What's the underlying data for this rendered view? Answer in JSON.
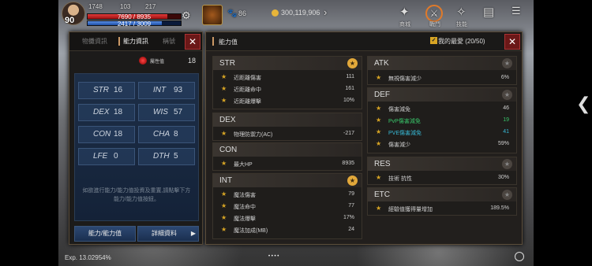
{
  "hud": {
    "level": "90",
    "buff1": "1748",
    "buff2": "103",
    "buff3": "217",
    "hp": "7690 / 8935",
    "hp_fraction": 0.86,
    "mp": "2417 / 3009",
    "mp_fraction": 0.8,
    "kills": "86",
    "gold": "300,119,906",
    "menu_labels": [
      "商城",
      "戰鬥",
      "技能"
    ]
  },
  "left": {
    "tabs": [
      "物攤資訊",
      "能力資訊",
      "稱號"
    ],
    "element_name": "屬性值",
    "element_value": "18",
    "stats": [
      {
        "name": "STR",
        "value": "16"
      },
      {
        "name": "INT",
        "value": "93"
      },
      {
        "name": "DEX",
        "value": "18"
      },
      {
        "name": "WIS",
        "value": "57"
      },
      {
        "name": "CON",
        "value": "18"
      },
      {
        "name": "CHA",
        "value": "8"
      },
      {
        "name": "LFE",
        "value": "0"
      },
      {
        "name": "DTH",
        "value": "5"
      }
    ],
    "hint": "如欲進行能力/能力值投資及重置,請點擊下方能力/能力值按鈕。",
    "btn_ability": "能力/能力值",
    "btn_detail": "詳細資料"
  },
  "right": {
    "title": "能力值",
    "favorite": "我的最愛 (20/50)",
    "groups": {
      "str": {
        "name": "STR",
        "rows": [
          {
            "n": "近距離傷害",
            "v": "111"
          },
          {
            "n": "近距離命中",
            "v": "161"
          },
          {
            "n": "近距離爆擊",
            "v": "10%"
          }
        ]
      },
      "dex": {
        "name": "DEX",
        "rows": [
          {
            "n": "物理防禦力(AC)",
            "v": "-217"
          }
        ]
      },
      "con": {
        "name": "CON",
        "rows": [
          {
            "n": "最大HP",
            "v": "8935"
          }
        ]
      },
      "int": {
        "name": "INT",
        "rows": [
          {
            "n": "魔法傷害",
            "v": "79"
          },
          {
            "n": "魔法命中",
            "v": "77"
          },
          {
            "n": "魔法爆擊",
            "v": "17%"
          },
          {
            "n": "魔法加成(MB)",
            "v": "24"
          }
        ]
      },
      "atk": {
        "name": "ATK",
        "rows": [
          {
            "n": "無視傷害減少",
            "v": "6%"
          }
        ]
      },
      "def": {
        "name": "DEF",
        "rows": [
          {
            "n": "傷害減免",
            "v": "46"
          },
          {
            "n": "PvP傷害減免",
            "v": "19"
          },
          {
            "n": "PVE傷害減免",
            "v": "41"
          },
          {
            "n": "傷害減少",
            "v": "59%"
          }
        ]
      },
      "res": {
        "name": "RES",
        "rows": [
          {
            "n": "技術 抗性",
            "v": "30%"
          }
        ]
      },
      "etc": {
        "name": "ETC",
        "rows": [
          {
            "n": "經驗值獲得量增加",
            "v": "189.5%"
          }
        ]
      }
    }
  },
  "exp": "Exp. 13.02954%"
}
